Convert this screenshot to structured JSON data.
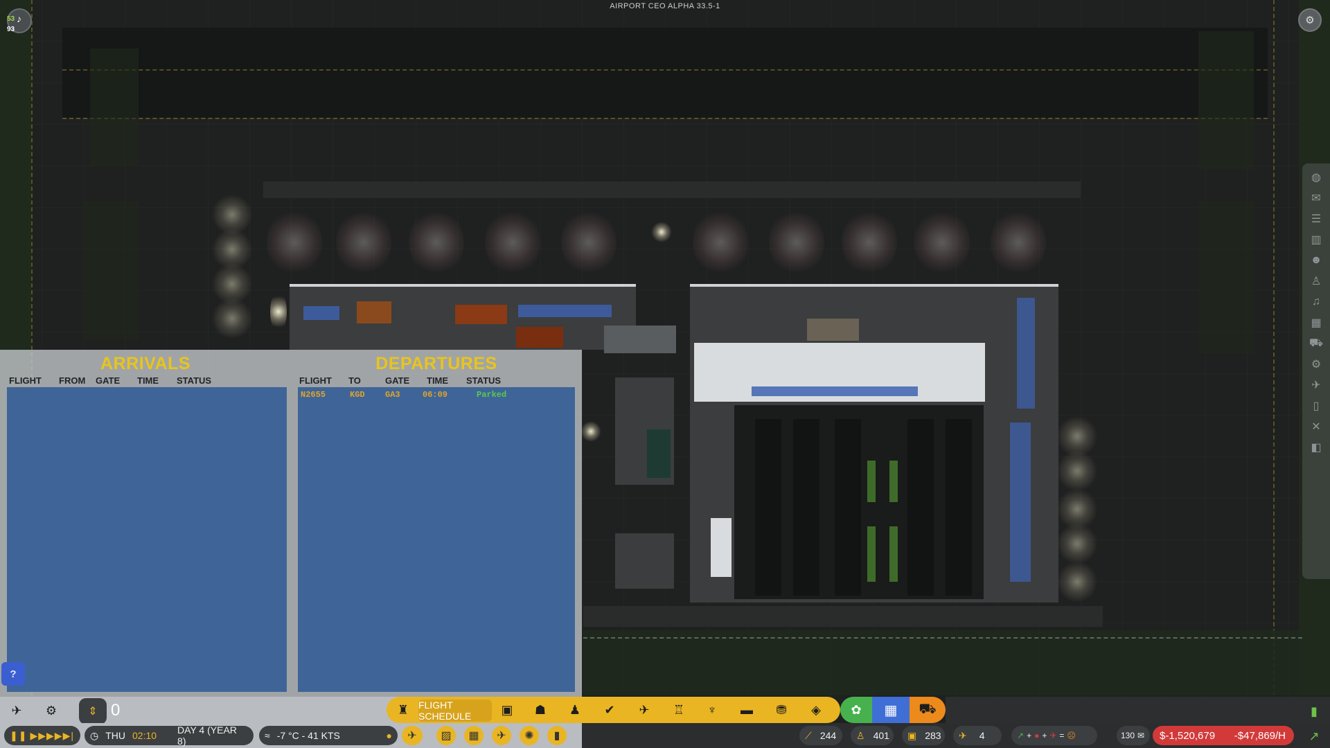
{
  "app": {
    "title": "AIRPORT CEO ALPHA 33.5-1",
    "alert_stat_a": "53",
    "alert_stat_b": "93"
  },
  "flight_schedule": {
    "arrivals": {
      "title": "ARRIVALS",
      "columns": [
        "FLIGHT",
        "FROM",
        "GATE",
        "TIME",
        "STATUS"
      ],
      "rows": []
    },
    "departures": {
      "title": "DEPARTURES",
      "columns": [
        "FLIGHT",
        "TO",
        "GATE",
        "TIME",
        "STATUS"
      ],
      "rows": [
        {
          "flight": "N2655",
          "to": "KGD",
          "gate": "GA3",
          "time": "06:09",
          "status": "Parked"
        }
      ]
    },
    "help_label": "?"
  },
  "toolbar": {
    "zoom_value": "0",
    "flight_schedule_tab": "FLIGHT SCHEDULE",
    "icons": [
      "control-tower-icon",
      "baggage-icon",
      "staff-icon",
      "passengers-icon",
      "security-icon",
      "plane-icon",
      "check-in-icon",
      "food-icon",
      "seating-icon",
      "shop-icon",
      "layers-icon"
    ]
  },
  "status": {
    "day_of_week": "THU",
    "clock": "02:10",
    "day_label": "DAY 4 (YEAR 8)",
    "weather": "-7 °C - 41 KTS",
    "stat_1": "244",
    "stat_2": "401",
    "stat_3": "283",
    "stat_4": "4",
    "mail_count": "130",
    "money": "$-1,520,679",
    "rate": "-$47,869/H"
  },
  "colors": {
    "accent_yellow": "#e9b523",
    "arrivals_title": "#e8c51b",
    "board_blue": "#3f6598",
    "money_red": "#d23a3a",
    "status_green": "#5cc84a"
  }
}
